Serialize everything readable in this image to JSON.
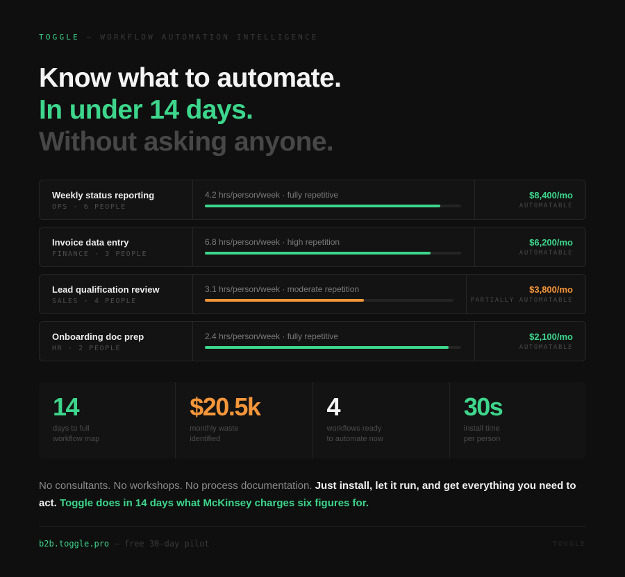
{
  "header": {
    "brand": "TOGGLE",
    "separator": " — ",
    "tagline": "WORKFLOW AUTOMATION INTELLIGENCE"
  },
  "headline": {
    "line1": "Know what to automate.",
    "line2": "In under 14 days.",
    "line3": "Without asking anyone."
  },
  "colors": {
    "accent": "#3dd68c",
    "warning": "#f5963a"
  },
  "workflows": [
    {
      "name": "Weekly status reporting",
      "meta": "OPS · 6 PEOPLE",
      "desc": "4.2 hrs/person/week · fully repetitive",
      "fill_fraction": 0.92,
      "amount": "$8,400/mo",
      "tag": "AUTOMATABLE",
      "status": "green"
    },
    {
      "name": "Invoice data entry",
      "meta": "FINANCE · 3 PEOPLE",
      "desc": "6.8 hrs/person/week · high repetition",
      "fill_fraction": 0.88,
      "amount": "$6,200/mo",
      "tag": "AUTOMATABLE",
      "status": "green"
    },
    {
      "name": "Lead qualification review",
      "meta": "SALES · 4 PEOPLE",
      "desc": "3.1 hrs/person/week · moderate repetition",
      "fill_fraction": 0.64,
      "amount": "$3,800/mo",
      "tag": "PARTIALLY AUTOMATABLE",
      "status": "orange"
    },
    {
      "name": "Onboarding doc prep",
      "meta": "HR · 2 PEOPLE",
      "desc": "2.4 hrs/person/week · fully repetitive",
      "fill_fraction": 0.95,
      "amount": "$2,100/mo",
      "tag": "AUTOMATABLE",
      "status": "green"
    }
  ],
  "stats": [
    {
      "value": "14",
      "label1": "days to full",
      "label2": "workflow map",
      "color": "#3dd68c"
    },
    {
      "value": "$20.5k",
      "label1": "monthly waste",
      "label2": "identified",
      "color": "#f5963a"
    },
    {
      "value": "4",
      "label1": "workflows ready",
      "label2": "to automate now",
      "color": "#f4f4f4"
    },
    {
      "value": "30s",
      "label1": "install time",
      "label2": "per person",
      "color": "#3dd68c"
    }
  ],
  "body": {
    "plain": "No consultants. No workshops. No process documentation. ",
    "strong": "Just install, let it run, and get everything you need to act.",
    "green": "Toggle does in 14 days what McKinsey charges six figures for."
  },
  "footer": {
    "url": "b2b.toggle.pro",
    "note": " — free 30-day pilot",
    "brand": "TOGGLE"
  }
}
